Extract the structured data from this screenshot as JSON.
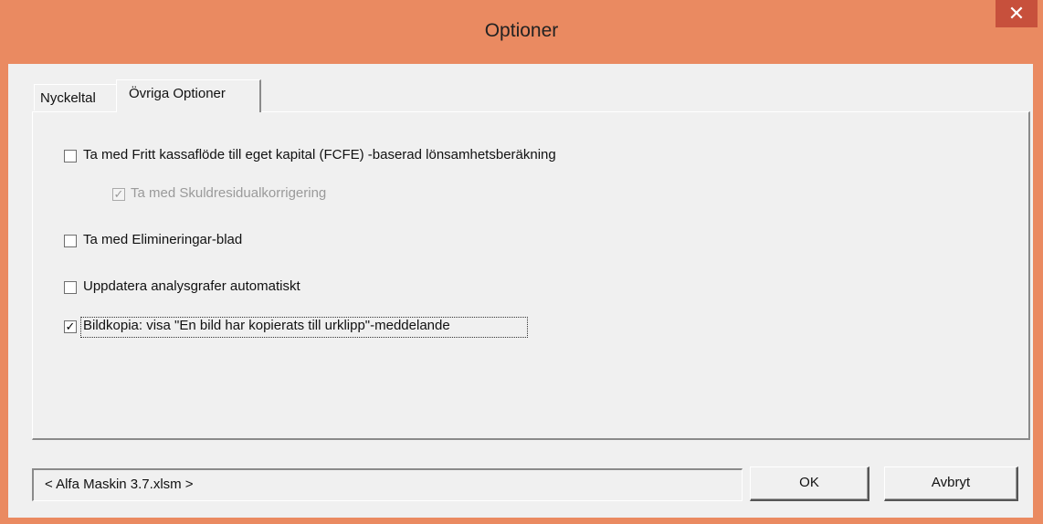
{
  "window": {
    "title": "Optioner",
    "close_label": "✕",
    "accent_color": "#ea8a61",
    "close_color": "#c7503c"
  },
  "tabs": [
    {
      "label": "Nyckeltal",
      "active": false
    },
    {
      "label": "Övriga Optioner",
      "active": true
    }
  ],
  "options": [
    {
      "label": "Ta med Fritt kassaflöde till eget kapital (FCFE) -baserad lönsamhetsberäkning",
      "checked": false,
      "enabled": true
    },
    {
      "label": "Ta med Skuldresidualkorrigering",
      "checked": true,
      "enabled": false
    },
    {
      "label": "Ta med Elimineringar-blad",
      "checked": false,
      "enabled": true
    },
    {
      "label": "Uppdatera analysgrafer automatiskt",
      "checked": false,
      "enabled": true
    },
    {
      "label": "Bildkopia: visa \"En bild har kopierats till urklipp\"-meddelande",
      "checked": true,
      "enabled": true,
      "focused": true
    }
  ],
  "status": {
    "text": "< Alfa Maskin 3.7.xlsm >"
  },
  "buttons": {
    "ok_label": "OK",
    "cancel_label": "Avbryt"
  }
}
